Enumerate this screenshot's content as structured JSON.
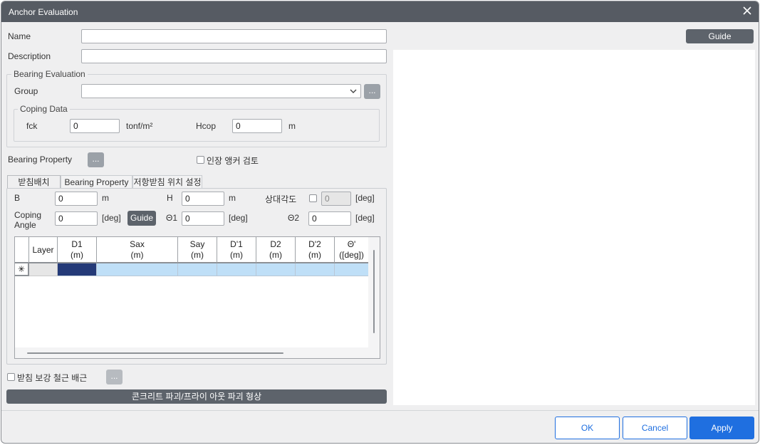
{
  "dialog": {
    "title": "Anchor Evaluation"
  },
  "form": {
    "name_label": "Name",
    "name_value": "",
    "description_label": "Description",
    "description_value": "",
    "guide_button": "Guide"
  },
  "bearing_eval": {
    "legend": "Bearing Evaluation",
    "group_label": "Group",
    "group_value": "",
    "group_more": "...",
    "coping": {
      "legend": "Coping Data",
      "fck_label": "fck",
      "fck_value": "0",
      "fck_unit": "tonf/m²",
      "hcop_label": "Hcop",
      "hcop_value": "0",
      "hcop_unit": "m"
    }
  },
  "bearing_property": {
    "label": "Bearing Property",
    "more": "...",
    "tension_check_label": "인장 앵커 검토"
  },
  "tabs": [
    {
      "label": "받침배치",
      "active": true
    },
    {
      "label": "Bearing Property",
      "active": false
    },
    {
      "label": "저항받침 위치 설정",
      "active": false
    }
  ],
  "layout_tab": {
    "b_label": "B",
    "b_value": "0",
    "b_unit": "m",
    "h_label": "H",
    "h_value": "0",
    "h_unit": "m",
    "relangle_label": "상대각도",
    "relangle_value": "0",
    "relangle_unit": "[deg]",
    "coping_angle_label_1": "Coping",
    "coping_angle_label_2": "Angle",
    "coping_angle_value": "0",
    "coping_angle_unit": "[deg]",
    "guide_button": "Guide",
    "theta1_label": "Θ1",
    "theta1_value": "0",
    "theta1_unit": "[deg]",
    "theta2_label": "Θ2",
    "theta2_value": "0",
    "theta2_unit": "[deg]"
  },
  "grid": {
    "columns": [
      {
        "l1": "Layer",
        "l2": ""
      },
      {
        "l1": "D1",
        "l2": "(m)"
      },
      {
        "l1": "Sax",
        "l2": "(m)"
      },
      {
        "l1": "Say",
        "l2": "(m)"
      },
      {
        "l1": "D'1",
        "l2": "(m)"
      },
      {
        "l1": "D2",
        "l2": "(m)"
      },
      {
        "l1": "D'2",
        "l2": "(m)"
      },
      {
        "l1": "Θ'",
        "l2": "([deg])"
      }
    ],
    "new_row_marker": "✳"
  },
  "rebar": {
    "label": "받침 보강 철근 배근",
    "more": "..."
  },
  "failure_shape_button": "콘크리트 파괴/프라이 아웃 파괴 형상",
  "footer": {
    "ok": "OK",
    "cancel": "Cancel",
    "apply": "Apply"
  },
  "colors": {
    "titlebar": "#565b63",
    "accent": "#1f6fe0",
    "selected_cell": "#243a78",
    "row_fill": "#bfdff7"
  }
}
